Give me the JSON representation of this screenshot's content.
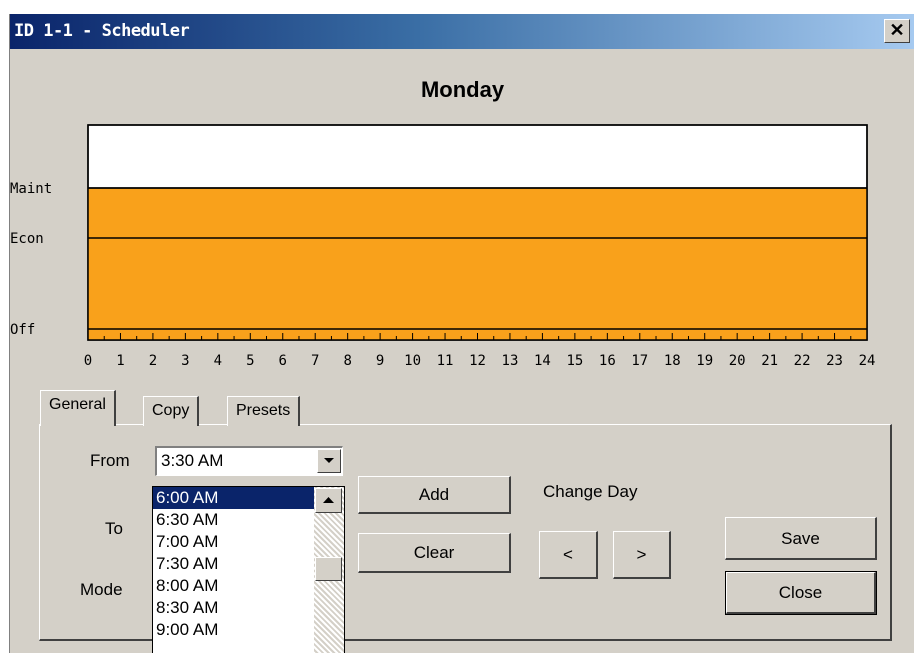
{
  "window": {
    "title": "ID 1-1 - Scheduler",
    "close_label": "✕"
  },
  "chart_data": {
    "type": "area",
    "title": "Monday",
    "x": [
      0,
      24
    ],
    "xlim": [
      0,
      24
    ],
    "xticks": [
      "0",
      "1",
      "2",
      "3",
      "4",
      "5",
      "6",
      "7",
      "8",
      "9",
      "10",
      "11",
      "12",
      "13",
      "14",
      "15",
      "16",
      "17",
      "18",
      "19",
      "20",
      "21",
      "22",
      "23",
      "24"
    ],
    "y_levels": [
      "Off",
      "Econ",
      "Maint"
    ],
    "series": [
      {
        "values": [
          "Maint",
          "Maint"
        ]
      }
    ],
    "fill_color": "#f9a11b",
    "grid": false
  },
  "tabs": [
    {
      "label": "General",
      "active": true
    },
    {
      "label": "Copy",
      "active": false
    },
    {
      "label": "Presets",
      "active": false
    }
  ],
  "form": {
    "from_label": "From",
    "to_label": "To",
    "mode_label": "Mode",
    "from_value": "3:30 AM",
    "time_options": [
      "6:00 AM",
      "6:30 AM",
      "7:00 AM",
      "7:30 AM",
      "8:00 AM",
      "8:30 AM",
      "9:00 AM"
    ],
    "selected_option": "6:00 AM"
  },
  "buttons": {
    "add": "Add",
    "clear": "Clear",
    "change_day_label": "Change Day",
    "prev_day": "<",
    "next_day": ">",
    "save": "Save",
    "close": "Close"
  }
}
